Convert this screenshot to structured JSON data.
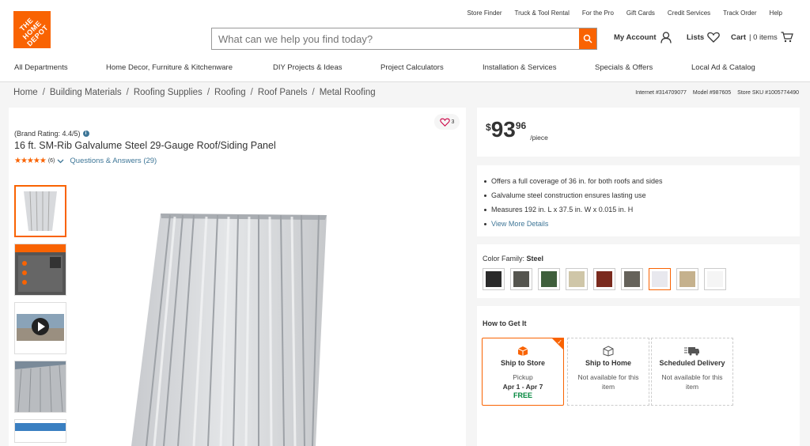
{
  "header": {
    "logo_text": "THE HOME DEPOT",
    "utility_links": [
      "Store Finder",
      "Truck & Tool Rental",
      "For the Pro",
      "Gift Cards",
      "Credit Services",
      "Track Order",
      "Help"
    ],
    "search_placeholder": "What can we help you find today?",
    "account_label": "My Account",
    "lists_label": "Lists",
    "cart_label": "Cart",
    "cart_count": "| 0 items"
  },
  "nav": [
    "All Departments",
    "Home Decor, Furniture & Kitchenware",
    "DIY Projects & Ideas",
    "Project Calculators",
    "Installation & Services",
    "Specials & Offers",
    "Local Ad & Catalog"
  ],
  "breadcrumbs": [
    "Home",
    "Building Materials",
    "Roofing Supplies",
    "Roofing",
    "Roof Panels",
    "Metal Roofing"
  ],
  "ids": {
    "internet": "Internet #314709077",
    "model": "Model #987605",
    "sku": "Store SKU #1005774490"
  },
  "product": {
    "brand_rating": "(Brand Rating: 4.4/5)",
    "title": "16 ft. SM-Rib Galvalume Steel 29-Gauge Roof/Siding Panel",
    "review_count": "(6)",
    "qa_label": "Questions & Answers (29)",
    "fav_count": "3",
    "stars": 5
  },
  "price": {
    "dollar": "$",
    "main": "93",
    "cents": "96",
    "unit": "/piece"
  },
  "highlights": [
    "Offers a full coverage of 36 in. for both roofs and sides",
    "Galvalume steel construction ensures lasting use",
    "Measures 192 in. L x 37.5 in. W x 0.015 in. H"
  ],
  "view_more": "View More Details",
  "color": {
    "label": "Color Family:",
    "value": "Steel",
    "swatches": [
      "#2a2a2a",
      "#55554f",
      "#3f5f3c",
      "#cfc6a8",
      "#7a2a1e",
      "#65625a",
      "#e8e8ee",
      "#c5b18d",
      "#f5f5f5"
    ],
    "selected_index": 6
  },
  "how_to_get": {
    "title": "How to Get It",
    "options": [
      {
        "title": "Ship to Store",
        "line1": "Pickup",
        "line2": "Apr 1 - Apr 7",
        "line3": "FREE"
      },
      {
        "title": "Ship to Home",
        "line1": "Not available for this",
        "line2": "item"
      },
      {
        "title": "Scheduled Delivery",
        "line1": "Not available for this",
        "line2": "item"
      }
    ]
  }
}
